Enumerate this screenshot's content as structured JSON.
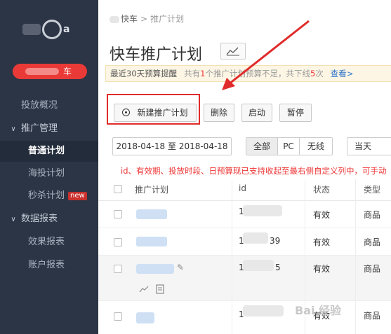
{
  "sidebar": {
    "logo": "logo",
    "quick_button": "车",
    "items": [
      {
        "label": "投放概况",
        "type": "item"
      },
      {
        "label": "推广管理",
        "type": "group",
        "arrow": "∨"
      },
      {
        "label": "普通计划",
        "type": "sub",
        "active": true
      },
      {
        "label": "海投计划",
        "type": "sub"
      },
      {
        "label": "秒杀计划",
        "type": "sub",
        "badge": "new"
      },
      {
        "label": "数据报表",
        "type": "group",
        "arrow": "∨"
      },
      {
        "label": "效果报表",
        "type": "sub"
      },
      {
        "label": "账户报表",
        "type": "sub"
      }
    ]
  },
  "breadcrumb": {
    "root": "快车",
    "sep": ">",
    "current": "推广计划"
  },
  "page_title": "快车推广计划",
  "notice": {
    "label": "最近30天预算提醒",
    "text_a": "共有",
    "count1": "1",
    "text_b": "个推广计划预算不足，共下线",
    "count2": "5",
    "text_c": "次",
    "link": "查看>"
  },
  "toolbar": {
    "new_plan": "新建推广计划",
    "delete": "删除",
    "start": "启动",
    "pause": "暂停"
  },
  "filter": {
    "date_range": "2018-04-18 至 2018-04-18",
    "segments": [
      "全部",
      "PC",
      "无线"
    ],
    "period": "当天"
  },
  "tip": "id、有效期、投放时段、日预算现已支持收起至最右侧自定义列中，可手动",
  "table": {
    "headers": [
      "推广计划",
      "id",
      "状态",
      "类型"
    ],
    "rows": [
      {
        "id_prefix": "1",
        "id_suffix": "",
        "status": "有效",
        "type": "商品"
      },
      {
        "id_prefix": "1",
        "id_suffix": "39",
        "status": "有效",
        "type": "商品"
      },
      {
        "id_prefix": "1",
        "id_suffix": "5",
        "status": "有效",
        "type": "商品"
      },
      {
        "id_prefix": "1",
        "id_suffix": "",
        "status": "有效",
        "type": "商品"
      }
    ]
  },
  "watermark": "Bai 经验",
  "colors": {
    "sidebar_bg": "#2b3546",
    "accent_red": "#ea3a37",
    "link_blue": "#2f75c9",
    "annotation_red": "#e02b2b"
  }
}
